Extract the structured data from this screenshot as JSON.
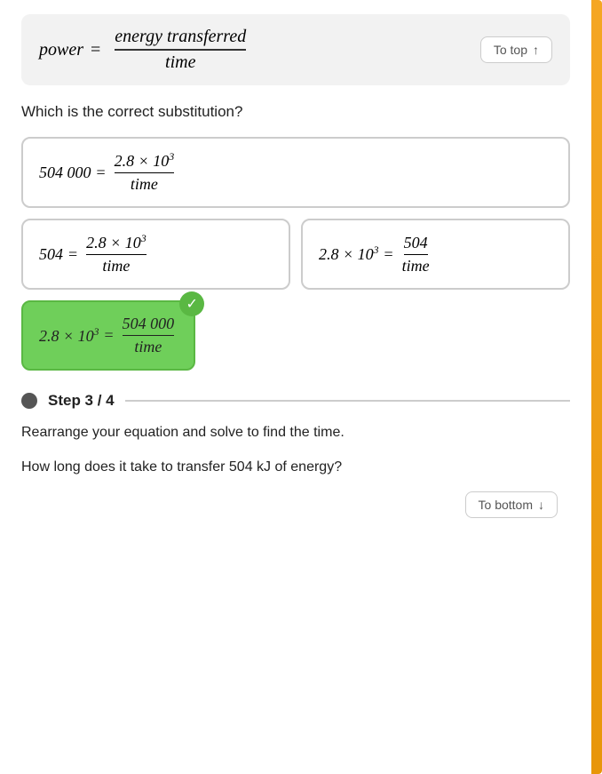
{
  "formula": {
    "left": "power",
    "equals": "=",
    "numerator": "energy transferred",
    "denominator": "time"
  },
  "to_top_button": "To top",
  "to_top_arrow": "↑",
  "question": "Which is the correct substitution?",
  "options": [
    {
      "id": "A",
      "left": "504 000",
      "equals": "=",
      "numerator": "2.8 × 10",
      "exp": "3",
      "denominator": "time",
      "correct": false
    },
    {
      "id": "B",
      "left": "504",
      "equals": "=",
      "numerator": "2.8 × 10",
      "exp": "3",
      "denominator": "time",
      "correct": false
    },
    {
      "id": "C",
      "left": "2.8 × 10",
      "exp": "3",
      "equals": "=",
      "numerator": "504",
      "denominator": "time",
      "correct": false
    },
    {
      "id": "D",
      "left": "2.8 × 10",
      "exp": "3",
      "equals": "=",
      "numerator": "504 000",
      "denominator": "time",
      "correct": true
    }
  ],
  "step": {
    "label": "Step 3 / 4",
    "body1": "Rearrange your equation and solve to find the time.",
    "body2": "How long does it take to transfer 504 kJ of energy?"
  },
  "to_bottom_button": "To bottom",
  "to_bottom_arrow": "↓"
}
